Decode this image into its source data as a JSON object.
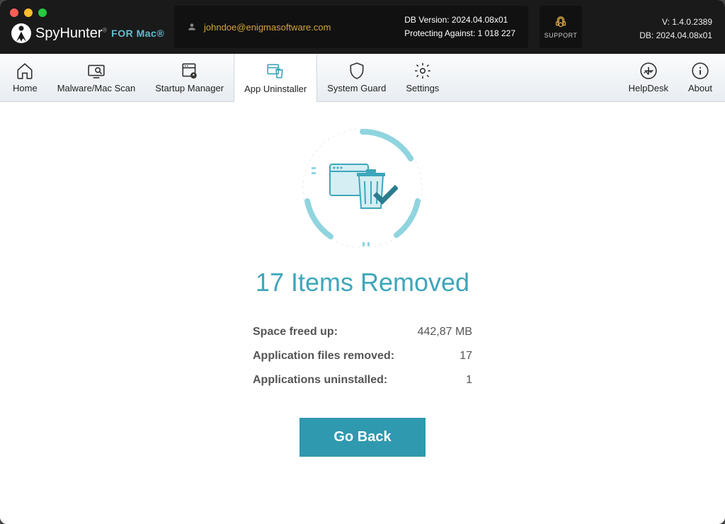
{
  "titlebar": {
    "app_name_1": "Spy",
    "app_name_2": "Hunter",
    "for_mac": "FOR Mac",
    "email": "johndoe@enigmasoftware.com",
    "db_version_label": "DB Version: 2024.04.08x01",
    "protecting_label": "Protecting Against: 1 018 227",
    "support_label": "SUPPORT",
    "version": "V: 1.4.0.2389",
    "db": "DB:  2024.04.08x01"
  },
  "toolbar": {
    "home": "Home",
    "scan": "Malware/Mac Scan",
    "startup": "Startup Manager",
    "uninstaller": "App Uninstaller",
    "guard": "System Guard",
    "settings": "Settings",
    "helpdesk": "HelpDesk",
    "about": "About"
  },
  "result": {
    "headline": "17 Items Removed",
    "space_label": "Space freed up:",
    "space_value": "442,87 MB",
    "files_label": "Application files removed:",
    "files_value": "17",
    "apps_label": "Applications uninstalled:",
    "apps_value": "1",
    "go_back": "Go Back"
  }
}
